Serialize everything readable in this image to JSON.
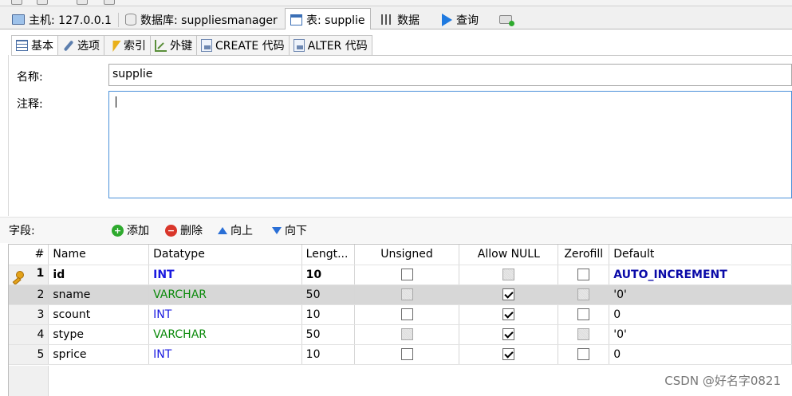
{
  "main_tabs": [
    {
      "label": "主机: 127.0.0.1",
      "icon": "monitor-icon"
    },
    {
      "label": "数据库: suppliesmanager",
      "icon": "database-icon"
    },
    {
      "label": "表: supplie",
      "icon": "table-icon"
    },
    {
      "label": "数据",
      "icon": "grid-icon"
    },
    {
      "label": "查询",
      "icon": "play-icon"
    },
    {
      "label": "",
      "icon": "new-tab-icon"
    }
  ],
  "sub_tabs": [
    {
      "label": "基本",
      "icon": "basic-icon"
    },
    {
      "label": "选项",
      "icon": "wrench-icon"
    },
    {
      "label": "索引",
      "icon": "lightning-icon"
    },
    {
      "label": "外键",
      "icon": "foreign-key-icon"
    },
    {
      "label": "CREATE 代码",
      "icon": "code-doc-icon"
    },
    {
      "label": "ALTER 代码",
      "icon": "code-doc-icon"
    }
  ],
  "form": {
    "name_label": "名称:",
    "name_value": "supplie",
    "comment_label": "注释:",
    "comment_value": ""
  },
  "fields_toolbar": {
    "label": "字段:",
    "add": "添加",
    "delete": "删除",
    "move_up": "向上",
    "move_down": "向下"
  },
  "columns": [
    "#",
    "Name",
    "Datatype",
    "Lengt...",
    "Unsigned",
    "Allow NULL",
    "Zerofill",
    "Default"
  ],
  "rows": [
    {
      "num": "1",
      "name": "id",
      "datatype": "INT",
      "length": "10",
      "unsigned": "unchecked",
      "allow_null": "disabled",
      "zerofill": "unchecked",
      "default": "AUTO_INCREMENT",
      "primary_key": true,
      "type_color": "#1a1ae0"
    },
    {
      "num": "2",
      "name": "sname",
      "datatype": "VARCHAR",
      "length": "50",
      "unsigned": "disabled",
      "allow_null": "checked",
      "zerofill": "disabled",
      "default": "'0'",
      "primary_key": false,
      "type_color": "#0a8a0a"
    },
    {
      "num": "3",
      "name": "scount",
      "datatype": "INT",
      "length": "10",
      "unsigned": "unchecked",
      "allow_null": "checked",
      "zerofill": "unchecked",
      "default": "0",
      "primary_key": false,
      "type_color": "#1a1ae0"
    },
    {
      "num": "4",
      "name": "stype",
      "datatype": "VARCHAR",
      "length": "50",
      "unsigned": "disabled",
      "allow_null": "checked",
      "zerofill": "disabled",
      "default": "'0'",
      "primary_key": false,
      "type_color": "#0a8a0a"
    },
    {
      "num": "5",
      "name": "sprice",
      "datatype": "INT",
      "length": "10",
      "unsigned": "unchecked",
      "allow_null": "checked",
      "zerofill": "unchecked",
      "default": "0",
      "primary_key": false,
      "type_color": "#1a1ae0"
    }
  ],
  "watermark": "CSDN @好名字0821"
}
